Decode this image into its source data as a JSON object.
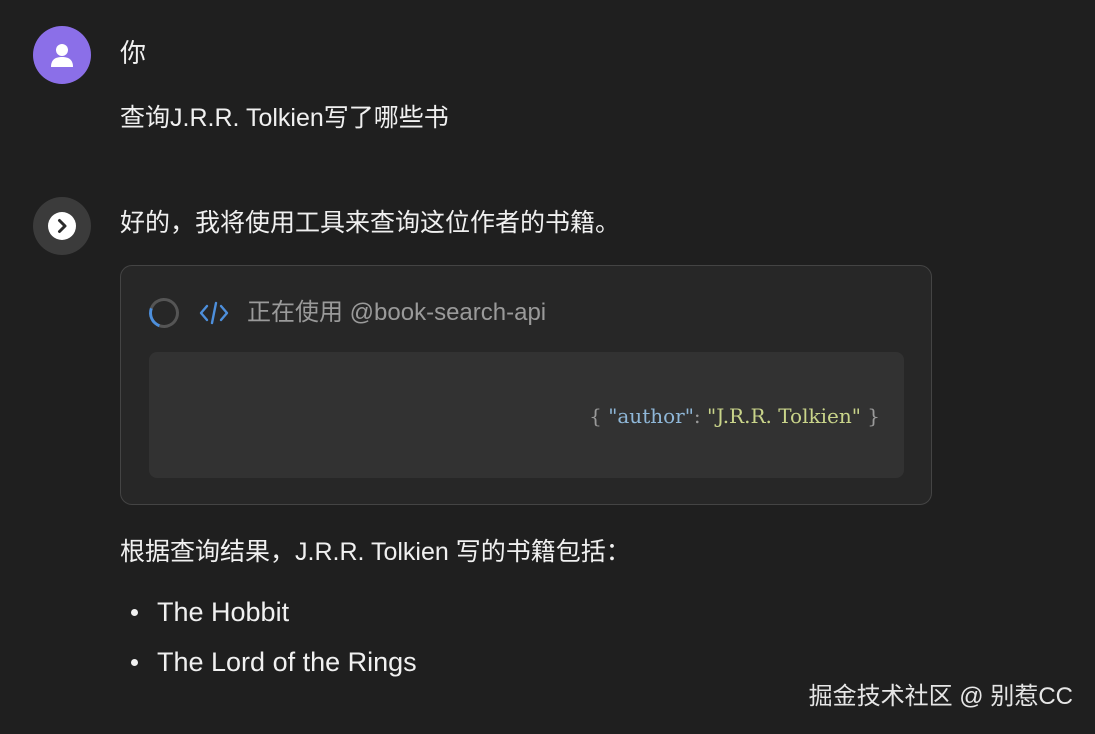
{
  "conversation": {
    "user": {
      "avatar_icon": "user-icon",
      "avatar_color": "#8b6fe8",
      "name": "你",
      "message": "查询J.R.R. Tolkien写了哪些书"
    },
    "assistant": {
      "avatar_icon": "chevron-right-icon",
      "intro": "好的，我将使用工具来查询这位作者的书籍。",
      "tool_call": {
        "spinner_icon": "loading-spinner-icon",
        "tool_icon": "code-icon",
        "status": "正在使用 @book-search-api",
        "args": {
          "open_brace": "{ ",
          "key": "\"author\"",
          "separator": ": ",
          "value": "\"J.R.R. Tolkien\"",
          "close_brace": " }"
        }
      },
      "result_intro": "根据查询结果，J.R.R. Tolkien 写的书籍包括：",
      "results": [
        "The Hobbit",
        "The Lord of the Rings"
      ]
    }
  },
  "watermark": "掘金技术社区 @ 别惹CC",
  "colors": {
    "background": "#1f1f1f",
    "accent_blue": "#4d8fdc",
    "json_key": "#8fb7d8",
    "json_value": "#c9d48a"
  }
}
